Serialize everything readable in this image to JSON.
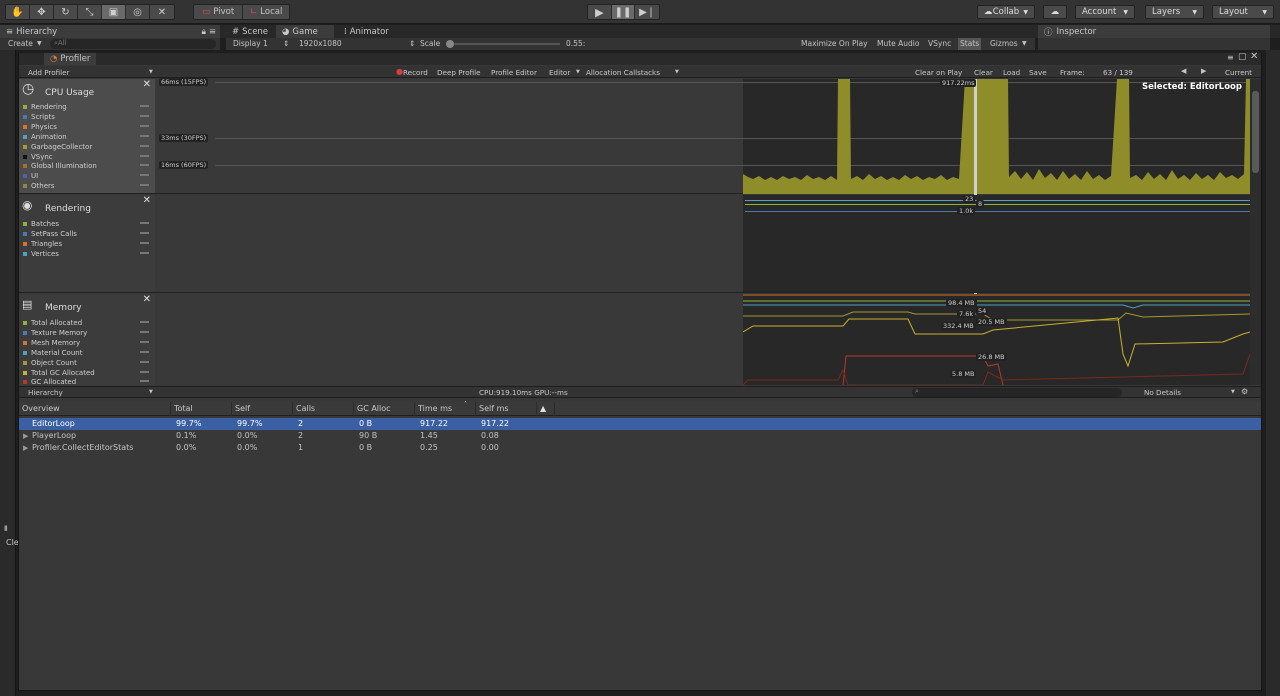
{
  "toolbar": {
    "tools": [
      "hand-icon",
      "move-icon",
      "rotate-icon",
      "scale-icon",
      "rect-icon",
      "transform-icon",
      "custom-tool-icon"
    ],
    "pivot": "Pivot",
    "local": "Local",
    "collab": "Collab",
    "account": "Account",
    "layers": "Layers",
    "layout": "Layout"
  },
  "dock": {
    "hierarchy_tab": "Hierarchy",
    "create": "Create",
    "search_placeholder": "All",
    "scene_tab": "Scene",
    "game_tab": "Game",
    "animator_tab": "Animator",
    "inspector_tab": "Inspector",
    "display": "Display 1",
    "resolution": "1920x1080",
    "scale_label": "Scale",
    "scale_value": "0.55:",
    "maximize": "Maximize On Play",
    "mute": "Mute Audio",
    "vsync": "VSync",
    "stats": "Stats",
    "gizmos": "Gizmos",
    "left_bottom": "Cle"
  },
  "profiler": {
    "tab": "Profiler",
    "add_profiler": "Add Profiler",
    "record": "Record",
    "deep_profile": "Deep Profile",
    "profile_editor": "Profile Editor",
    "editor": "Editor",
    "alloc_callstacks": "Allocation Callstacks",
    "clear_on_play": "Clear on Play",
    "clear": "Clear",
    "load": "Load",
    "save": "Save",
    "frame_label": "Frame:",
    "frame_value": "63 / 139",
    "current": "Current",
    "selected": "Selected: EditorLoop",
    "cpu": {
      "title": "CPU Usage",
      "legend": [
        {
          "name": "Rendering",
          "color": "#8fb33a"
        },
        {
          "name": "Scripts",
          "color": "#4a7ab5"
        },
        {
          "name": "Physics",
          "color": "#d0752b"
        },
        {
          "name": "Animation",
          "color": "#4fa1bf"
        },
        {
          "name": "GarbageCollector",
          "color": "#a29a2b"
        },
        {
          "name": "VSync",
          "color": "#111111"
        },
        {
          "name": "Global Illumination",
          "color": "#a0722b"
        },
        {
          "name": "UI",
          "color": "#5a5ab0"
        },
        {
          "name": "Others",
          "color": "#8a8a40"
        }
      ],
      "grid": [
        "66ms (15FPS)",
        "33ms (30FPS)",
        "16ms (60FPS)"
      ],
      "peak": "917.22ms"
    },
    "rendering": {
      "title": "Rendering",
      "legend": [
        {
          "name": "Batches",
          "color": "#8fb33a"
        },
        {
          "name": "SetPass Calls",
          "color": "#4a7ab5"
        },
        {
          "name": "Triangles",
          "color": "#d0752b"
        },
        {
          "name": "Vertices",
          "color": "#4fa1bf"
        }
      ],
      "tags": [
        "23",
        "8",
        "1.0k"
      ]
    },
    "memory": {
      "title": "Memory",
      "legend": [
        {
          "name": "Total Allocated",
          "color": "#8fb33a"
        },
        {
          "name": "Texture Memory",
          "color": "#4a7ab5"
        },
        {
          "name": "Mesh Memory",
          "color": "#d0752b"
        },
        {
          "name": "Material Count",
          "color": "#4fa1bf"
        },
        {
          "name": "Object Count",
          "color": "#a29a2b"
        },
        {
          "name": "Total GC Allocated",
          "color": "#c9b22b"
        },
        {
          "name": "GC Allocated",
          "color": "#b53a2b"
        }
      ],
      "tags": [
        "98.4 MB",
        "7.6k",
        "54",
        "20.5 MB",
        "332.4 MB",
        "26.8 MB",
        "5.8 MB"
      ]
    },
    "detail": {
      "view": "Hierarchy",
      "cpu_gpu": "CPU:919.10ms   GPU:--ms",
      "no_details": "No Details",
      "columns": [
        "Overview",
        "Total",
        "Self",
        "Calls",
        "GC Alloc",
        "Time ms",
        "Self ms"
      ],
      "rows": [
        {
          "name": "EditorLoop",
          "total": "99.7%",
          "self": "99.7%",
          "calls": "2",
          "gc": "0 B",
          "time": "917.22",
          "selfms": "917.22"
        },
        {
          "name": "PlayerLoop",
          "total": "0.1%",
          "self": "0.0%",
          "calls": "2",
          "gc": "90 B",
          "time": "1.45",
          "selfms": "0.08"
        },
        {
          "name": "Profiler.CollectEditorStats",
          "total": "0.0%",
          "self": "0.0%",
          "calls": "1",
          "gc": "0 B",
          "time": "0.25",
          "selfms": "0.00"
        }
      ]
    }
  }
}
